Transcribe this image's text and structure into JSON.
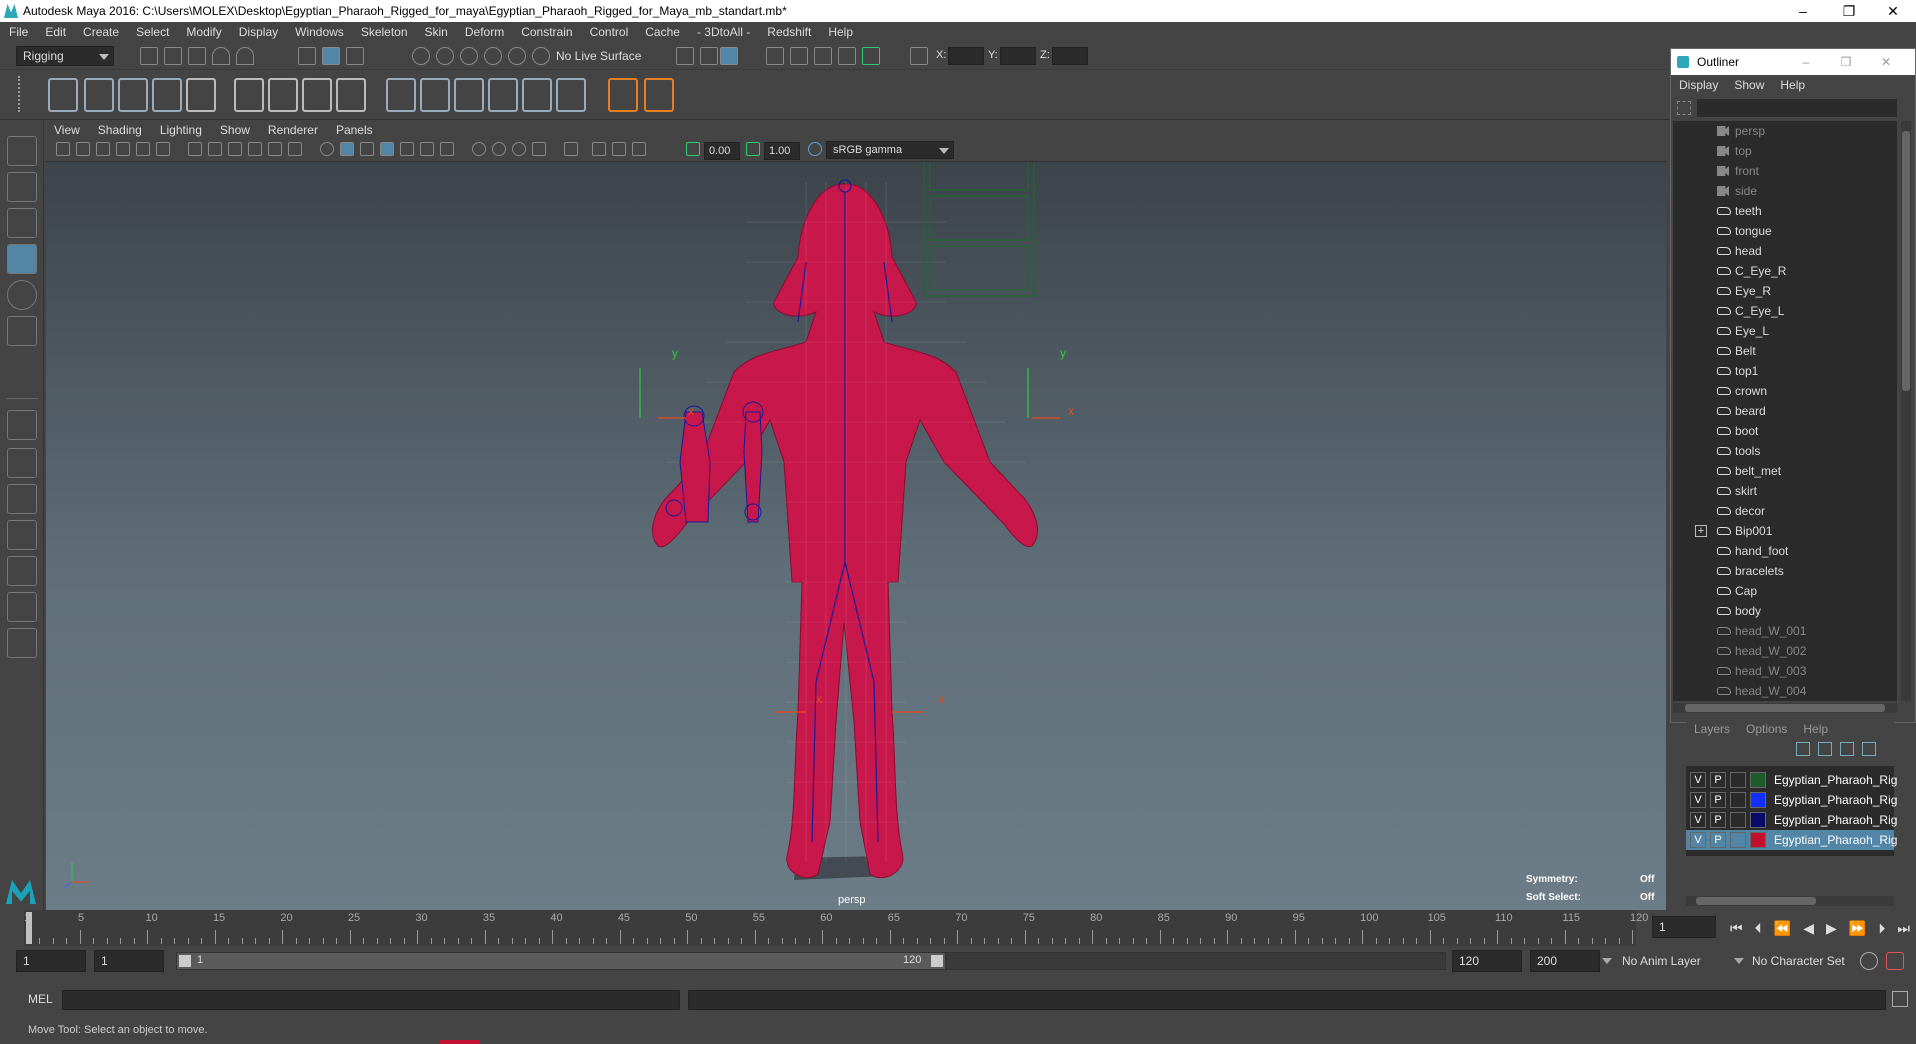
{
  "window": {
    "title": "Autodesk Maya 2016: C:\\Users\\MOLEX\\Desktop\\Egyptian_Pharaoh_Rigged_for_maya\\Egyptian_Pharaoh_Rigged_for_Maya_mb_standart.mb*",
    "minimize": "–",
    "restore": "❐",
    "close": "✕"
  },
  "menubar": [
    "File",
    "Edit",
    "Create",
    "Select",
    "Modify",
    "Display",
    "Windows",
    "Skeleton",
    "Skin",
    "Deform",
    "Constrain",
    "Control",
    "Cache",
    "- 3DtoAll -",
    "Redshift",
    "Help"
  ],
  "statusline": {
    "menuset": "Rigging",
    "live_surface": "No Live Surface",
    "x_label": "X:",
    "y_label": "Y:",
    "z_label": "Z:"
  },
  "viewport": {
    "menu": [
      "View",
      "Shading",
      "Lighting",
      "Show",
      "Renderer",
      "Panels"
    ],
    "exposure": "0.00",
    "gamma": "1.00",
    "colorspace": "sRGB gamma",
    "camera_label": "persp",
    "hud": {
      "symmetry_label": "Symmetry:",
      "symmetry_value": "Off",
      "soft_select_label": "Soft Select:",
      "soft_select_value": "Off"
    },
    "axis_labels": {
      "x": "x",
      "y": "y"
    }
  },
  "outliner": {
    "title": "Outliner",
    "menu": [
      "Display",
      "Show",
      "Help"
    ],
    "items": [
      {
        "label": "persp",
        "type": "camera",
        "dim": true
      },
      {
        "label": "top",
        "type": "camera",
        "dim": true
      },
      {
        "label": "front",
        "type": "camera",
        "dim": true
      },
      {
        "label": "side",
        "type": "camera",
        "dim": true
      },
      {
        "label": "teeth",
        "type": "mesh",
        "dim": false
      },
      {
        "label": "tongue",
        "type": "mesh",
        "dim": false
      },
      {
        "label": "head",
        "type": "mesh",
        "dim": false
      },
      {
        "label": "C_Eye_R",
        "type": "mesh",
        "dim": false
      },
      {
        "label": "Eye_R",
        "type": "mesh",
        "dim": false
      },
      {
        "label": "C_Eye_L",
        "type": "mesh",
        "dim": false
      },
      {
        "label": "Eye_L",
        "type": "mesh",
        "dim": false
      },
      {
        "label": "Belt",
        "type": "mesh",
        "dim": false
      },
      {
        "label": "top1",
        "type": "mesh",
        "dim": false
      },
      {
        "label": "crown",
        "type": "mesh",
        "dim": false
      },
      {
        "label": "beard",
        "type": "mesh",
        "dim": false
      },
      {
        "label": "boot",
        "type": "mesh",
        "dim": false
      },
      {
        "label": "tools",
        "type": "mesh",
        "dim": false
      },
      {
        "label": "belt_met",
        "type": "mesh",
        "dim": false
      },
      {
        "label": "skirt",
        "type": "mesh",
        "dim": false
      },
      {
        "label": "decor",
        "type": "mesh",
        "dim": false
      },
      {
        "label": "Bip001",
        "type": "joint",
        "dim": false,
        "expandable": true
      },
      {
        "label": "hand_foot",
        "type": "mesh",
        "dim": false
      },
      {
        "label": "bracelets",
        "type": "mesh",
        "dim": false
      },
      {
        "label": "Cap",
        "type": "mesh",
        "dim": false
      },
      {
        "label": "body",
        "type": "mesh",
        "dim": false
      },
      {
        "label": "head_W_001",
        "type": "mesh",
        "dim": true
      },
      {
        "label": "head_W_002",
        "type": "mesh",
        "dim": true
      },
      {
        "label": "head_W_003",
        "type": "mesh",
        "dim": true
      },
      {
        "label": "head_W_004",
        "type": "mesh",
        "dim": true
      }
    ]
  },
  "layers": {
    "menu": [
      "Layers",
      "Options",
      "Help"
    ],
    "rows": [
      {
        "v": "V",
        "p": "P",
        "color": "#1a5c2a",
        "name": "Egyptian_Pharaoh_Rig",
        "selected": false
      },
      {
        "v": "V",
        "p": "P",
        "color": "#1030ff",
        "name": "Egyptian_Pharaoh_Rig",
        "selected": false
      },
      {
        "v": "V",
        "p": "P",
        "color": "#0a0a6a",
        "name": "Egyptian_Pharaoh_Rig",
        "selected": false
      },
      {
        "v": "V",
        "p": "P",
        "color": "#c41030",
        "name": "Egyptian_Pharaoh_Rig",
        "selected": true
      }
    ]
  },
  "timeline": {
    "ticks": [
      "1",
      "5",
      "10",
      "15",
      "20",
      "25",
      "30",
      "35",
      "40",
      "45",
      "50",
      "55",
      "60",
      "65",
      "70",
      "75",
      "80",
      "85",
      "90",
      "95",
      "100",
      "105",
      "110",
      "115",
      "120"
    ],
    "current_frame": "1"
  },
  "range": {
    "start": "1",
    "playback_start": "1",
    "slider_start": "1",
    "slider_end": "120",
    "playback_end": "120",
    "end": "200",
    "anim_layer": "No Anim Layer",
    "character_set": "No Character Set"
  },
  "cmdline": {
    "label": "MEL"
  },
  "helpline": {
    "text": "Move Tool: Select an object to move."
  },
  "colors": {
    "wireframe": "#c8174a",
    "joint": "#1a1a9a",
    "accent": "#5285a6"
  }
}
